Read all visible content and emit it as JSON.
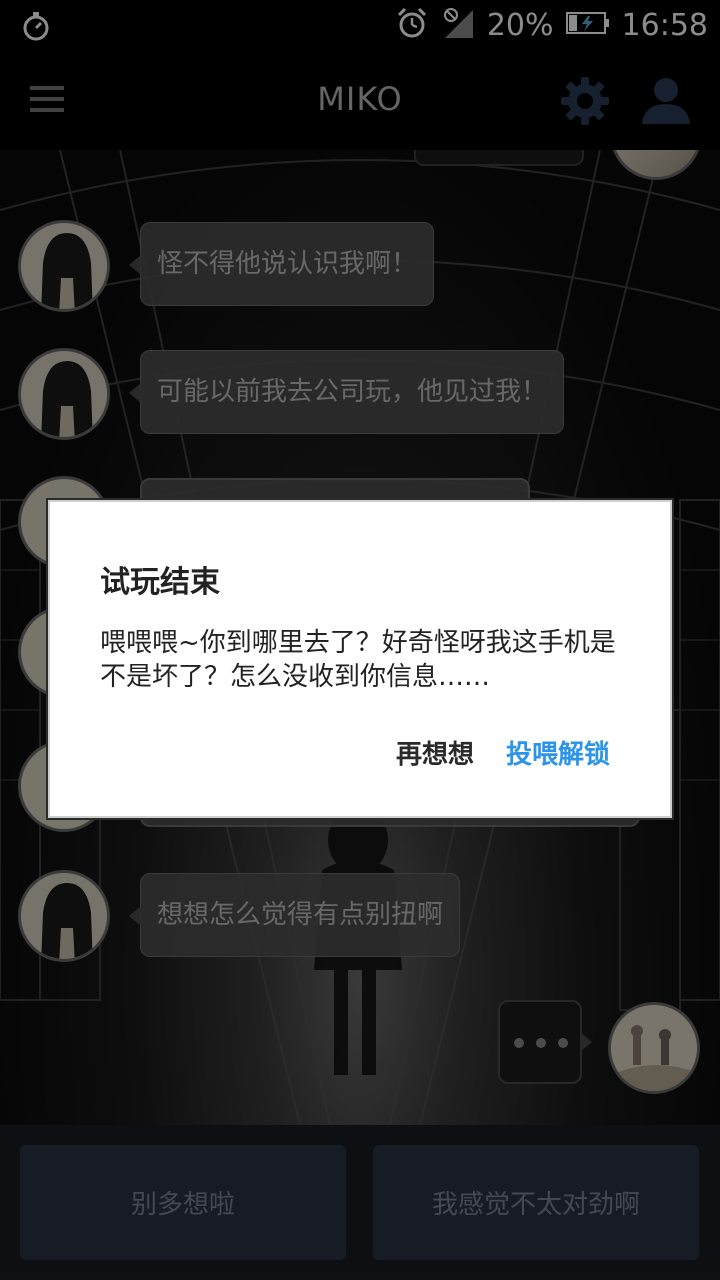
{
  "status_bar": {
    "battery_percent": "20%",
    "time": "16:58",
    "icons": [
      "stopwatch-icon",
      "alarm-icon",
      "no-signal-icon",
      "battery-charging-icon"
    ]
  },
  "app_bar": {
    "title": "MIKO",
    "icons": [
      "menu-icon",
      "gear-icon",
      "user-icon"
    ]
  },
  "chat": {
    "messages": [
      {
        "side": "left",
        "text": "怪不得他说认识我啊！"
      },
      {
        "side": "left",
        "text": "可能以前我去公司玩，他见过我！"
      },
      {
        "side": "left",
        "text": "想想怎么觉得有点别扭啊"
      }
    ],
    "typing_indicator": "..."
  },
  "choices": [
    "别多想啦",
    "我感觉不太对劲啊"
  ],
  "dialog": {
    "title": "试玩结束",
    "message": "喂喂喂~你到哪里去了？好奇怪呀我这手机是不是坏了？怎么没收到你信息……",
    "cancel_label": "再想想",
    "confirm_label": "投喂解锁"
  },
  "colors": {
    "accent": "#2d95e8",
    "choice_bg": "#2a3240",
    "bubble_bg": "#505050"
  }
}
